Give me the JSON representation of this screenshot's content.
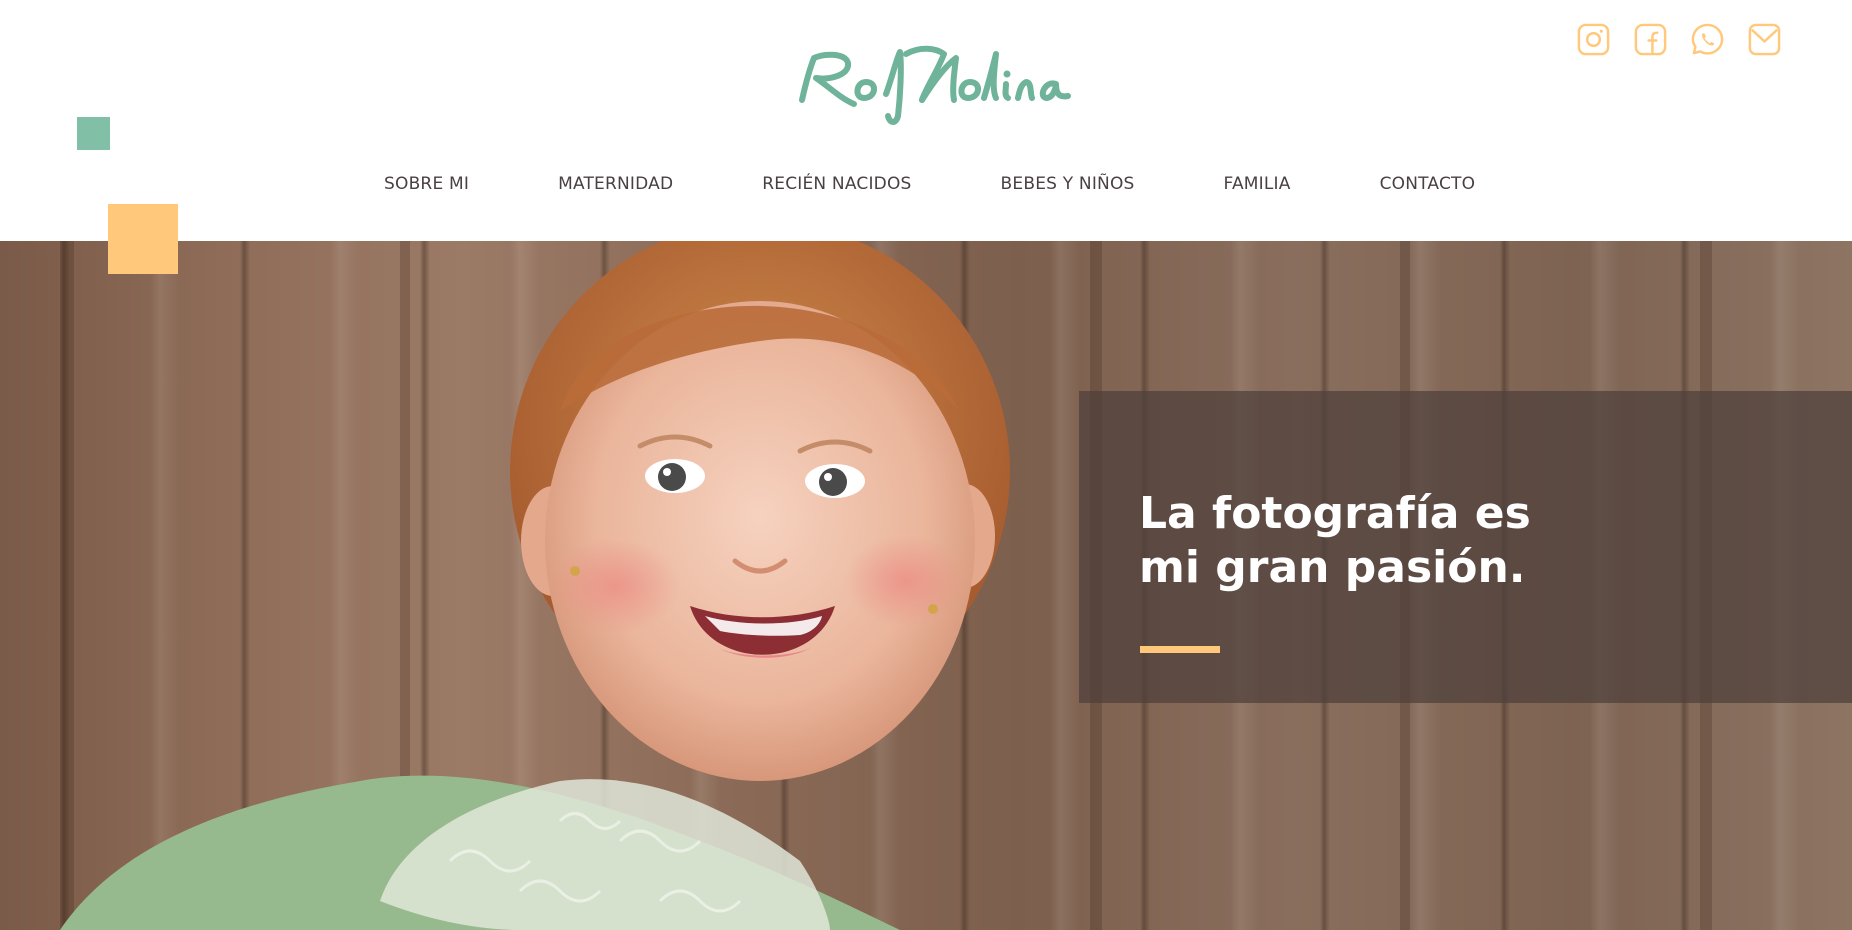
{
  "brand": {
    "logo_text": "RoMolina"
  },
  "social": [
    {
      "name": "instagram-icon"
    },
    {
      "name": "facebook-icon"
    },
    {
      "name": "whatsapp-icon"
    },
    {
      "name": "mail-icon"
    }
  ],
  "nav": {
    "items": [
      {
        "label": "SOBRE MI"
      },
      {
        "label": "MATERNIDAD"
      },
      {
        "label": "RECIÉN NACIDOS"
      },
      {
        "label": "BEBES Y NIÑOS"
      },
      {
        "label": "FAMILIA"
      },
      {
        "label": "CONTACTO"
      }
    ]
  },
  "hero": {
    "headline_line1": "La fotografía es",
    "headline_line2": "mi gran pasión."
  },
  "colors": {
    "brand_green": "#82bfa7",
    "accent_yellow": "#ffc87a",
    "nav_text": "#4a3f44",
    "overlay": "#4e403c"
  }
}
